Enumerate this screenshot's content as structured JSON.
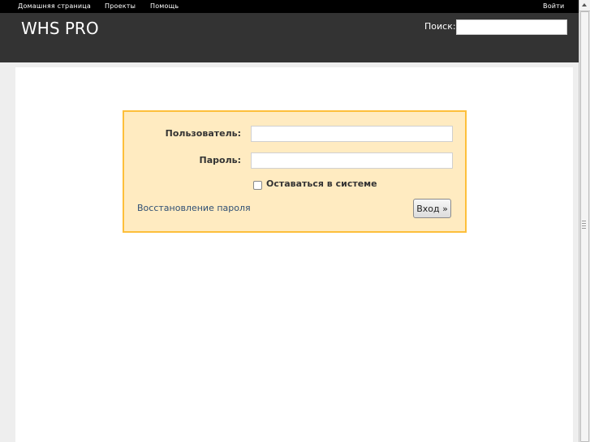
{
  "top_menu": {
    "home": "Домашняя страница",
    "projects": "Проекты",
    "help": "Помощь",
    "sign_in": "Войти"
  },
  "header": {
    "title": "WHS PRO",
    "search_label": "Поиск:",
    "search_value": ""
  },
  "login_form": {
    "username_label": "Пользователь:",
    "username_value": "",
    "password_label": "Пароль:",
    "password_value": "",
    "autologin_label": "Оставаться в системе",
    "autologin_checked": false,
    "lost_password_link": "Восстановление пароля",
    "submit_label": "Вход »"
  },
  "colors": {
    "top_menu_bg": "#000000",
    "header_bg": "#333333",
    "login_box_bg": "#ffebc1",
    "login_box_border": "#fdbf3b",
    "link": "#2f4f74"
  }
}
